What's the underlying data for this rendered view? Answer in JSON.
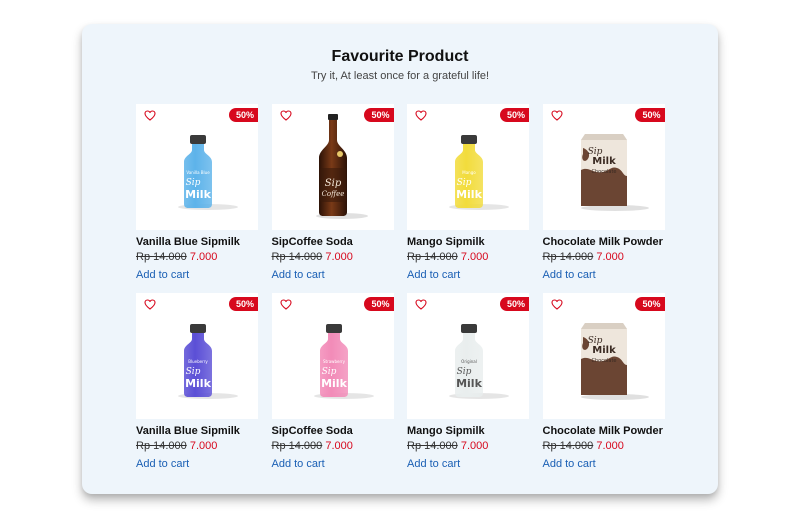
{
  "section": {
    "title": "Favourite Product",
    "subtitle": "Try it, At least once for a grateful life!"
  },
  "colors": {
    "badge": "#d7081d",
    "price_new": "#d7081d",
    "link": "#1a5fb4",
    "card_bg": "#eef5fb"
  },
  "products": [
    {
      "name": "Vanilla Blue Sipmilk",
      "old_price": "Rp 14.000",
      "new_price": "7.000",
      "badge": "50%",
      "cta": "Add to cart",
      "image": "blue-milk-bottle",
      "liquid": "#5db3ea",
      "label_text": "Vanilla Blue",
      "brand": "Sip",
      "brand2": "Milk"
    },
    {
      "name": "SipCoffee Soda",
      "old_price": "Rp 14.000",
      "new_price": "7.000",
      "badge": "50%",
      "cta": "Add to cart",
      "image": "brown-coffee-bottle",
      "liquid": "#5a2d14",
      "label_text": "",
      "brand": "Sip",
      "brand2": "Coffee"
    },
    {
      "name": "Mango Sipmilk",
      "old_price": "Rp 14.000",
      "new_price": "7.000",
      "badge": "50%",
      "cta": "Add to cart",
      "image": "yellow-milk-bottle",
      "liquid": "#f2dc3c",
      "label_text": "Mango",
      "brand": "Sip",
      "brand2": "Milk"
    },
    {
      "name": "Chocolate Milk Powder",
      "old_price": "Rp 14.000",
      "new_price": "7.000",
      "badge": "50%",
      "cta": "Add to cart",
      "image": "chocolate-milk-pack",
      "liquid": "#6b4533",
      "label_text": "Chocolate",
      "brand": "Sip",
      "brand2": "Milk"
    },
    {
      "name": "Vanilla Blue Sipmilk",
      "old_price": "Rp 14.000",
      "new_price": "7.000",
      "badge": "50%",
      "cta": "Add to cart",
      "image": "purple-milk-bottle",
      "liquid": "#5b4fd6",
      "label_text": "Blueberry",
      "brand": "Sip",
      "brand2": "Milk"
    },
    {
      "name": "SipCoffee Soda",
      "old_price": "Rp 14.000",
      "new_price": "7.000",
      "badge": "50%",
      "cta": "Add to cart",
      "image": "pink-milk-bottle",
      "liquid": "#f28bb8",
      "label_text": "Strawberry",
      "brand": "Sip",
      "brand2": "Milk"
    },
    {
      "name": "Mango Sipmilk",
      "old_price": "Rp 14.000",
      "new_price": "7.000",
      "badge": "50%",
      "cta": "Add to cart",
      "image": "white-milk-bottle",
      "liquid": "#e9eeee",
      "label_text": "Original",
      "brand": "Sip",
      "brand2": "Milk"
    },
    {
      "name": "Chocolate Milk Powder",
      "old_price": "Rp 14.000",
      "new_price": "7.000",
      "badge": "50%",
      "cta": "Add to cart",
      "image": "chocolate-milk-pack",
      "liquid": "#6b4533",
      "label_text": "Chocolate",
      "brand": "Sip",
      "brand2": "Milk"
    }
  ]
}
